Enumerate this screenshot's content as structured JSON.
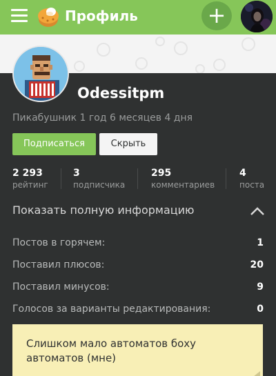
{
  "header": {
    "title": "Профиль",
    "icons": {
      "menu": "hamburger-menu-icon",
      "logo": "cupcake-logo-icon",
      "add": "plus-icon"
    },
    "add_label": "+",
    "colors": {
      "bar": "#86c659",
      "add_button": "#6aa84a"
    }
  },
  "profile": {
    "username": "Odessitpm",
    "tenure": "Пикабушник 1 год 6 месяцев 4 дня",
    "buttons": {
      "subscribe": "Подписаться",
      "hide": "Скрыть"
    }
  },
  "stats": [
    {
      "value": "2 293",
      "label": "рейтинг"
    },
    {
      "value": "3",
      "label": "подписчика"
    },
    {
      "value": "295",
      "label": "комментариев"
    },
    {
      "value": "4",
      "label": "поста"
    }
  ],
  "info": {
    "header": "Показать полную информацию",
    "rows": [
      {
        "label": "Постов в горячем:",
        "value": "1"
      },
      {
        "label": "Поставил плюсов:",
        "value": "20"
      },
      {
        "label": "Поставил минусов:",
        "value": "9"
      },
      {
        "label": "Голосов за варианты редактирования:",
        "value": "0"
      }
    ]
  },
  "note": {
    "text": "Слишком мало автоматов боху автоматов (мне)"
  },
  "colors": {
    "accent": "#86c659",
    "background": "#2f3131",
    "note": "#f8efb6"
  }
}
